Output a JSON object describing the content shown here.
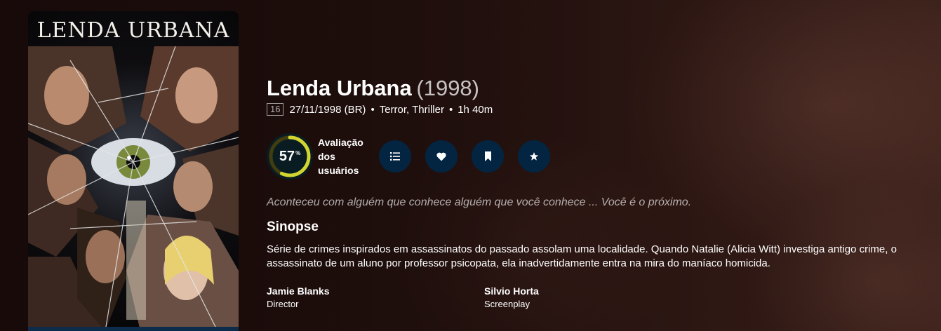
{
  "poster": {
    "title": "LENDA URBANA"
  },
  "movie": {
    "title": "Lenda Urbana",
    "year": "(1998)",
    "certification": "16",
    "release": "27/11/1998 (BR)",
    "genres": "Terror, Thriller",
    "runtime": "1h 40m",
    "separator": "•"
  },
  "score": {
    "value": "57",
    "unit": "%",
    "fraction": 0.57,
    "label_line1": "Avaliação",
    "label_line2": "dos",
    "label_line3": "usuários",
    "color": "#d2d531",
    "track_color": "#423d0f"
  },
  "actions": [
    {
      "icon": "list-icon"
    },
    {
      "icon": "heart-icon"
    },
    {
      "icon": "bookmark-icon"
    },
    {
      "icon": "star-icon"
    }
  ],
  "tagline": "Aconteceu com alguém que conhece alguém que você conhece ... Você é o próximo.",
  "overview": {
    "heading": "Sinopse",
    "text": "Série de crimes inspirados em assassinatos do passado assolam uma localidade. Quando Natalie (Alicia Witt) investiga antigo crime, o assassinato de um aluno por professor psicopata, ela inadvertidamente entra na mira do maníaco homicida."
  },
  "crew": [
    {
      "name": "Jamie Blanks",
      "job": "Director"
    },
    {
      "name": "Silvio Horta",
      "job": "Screenplay"
    }
  ],
  "colors": {
    "button_bg": "#032541",
    "score_bg": "#081c22",
    "poster_bar": "#0d2b4a"
  }
}
